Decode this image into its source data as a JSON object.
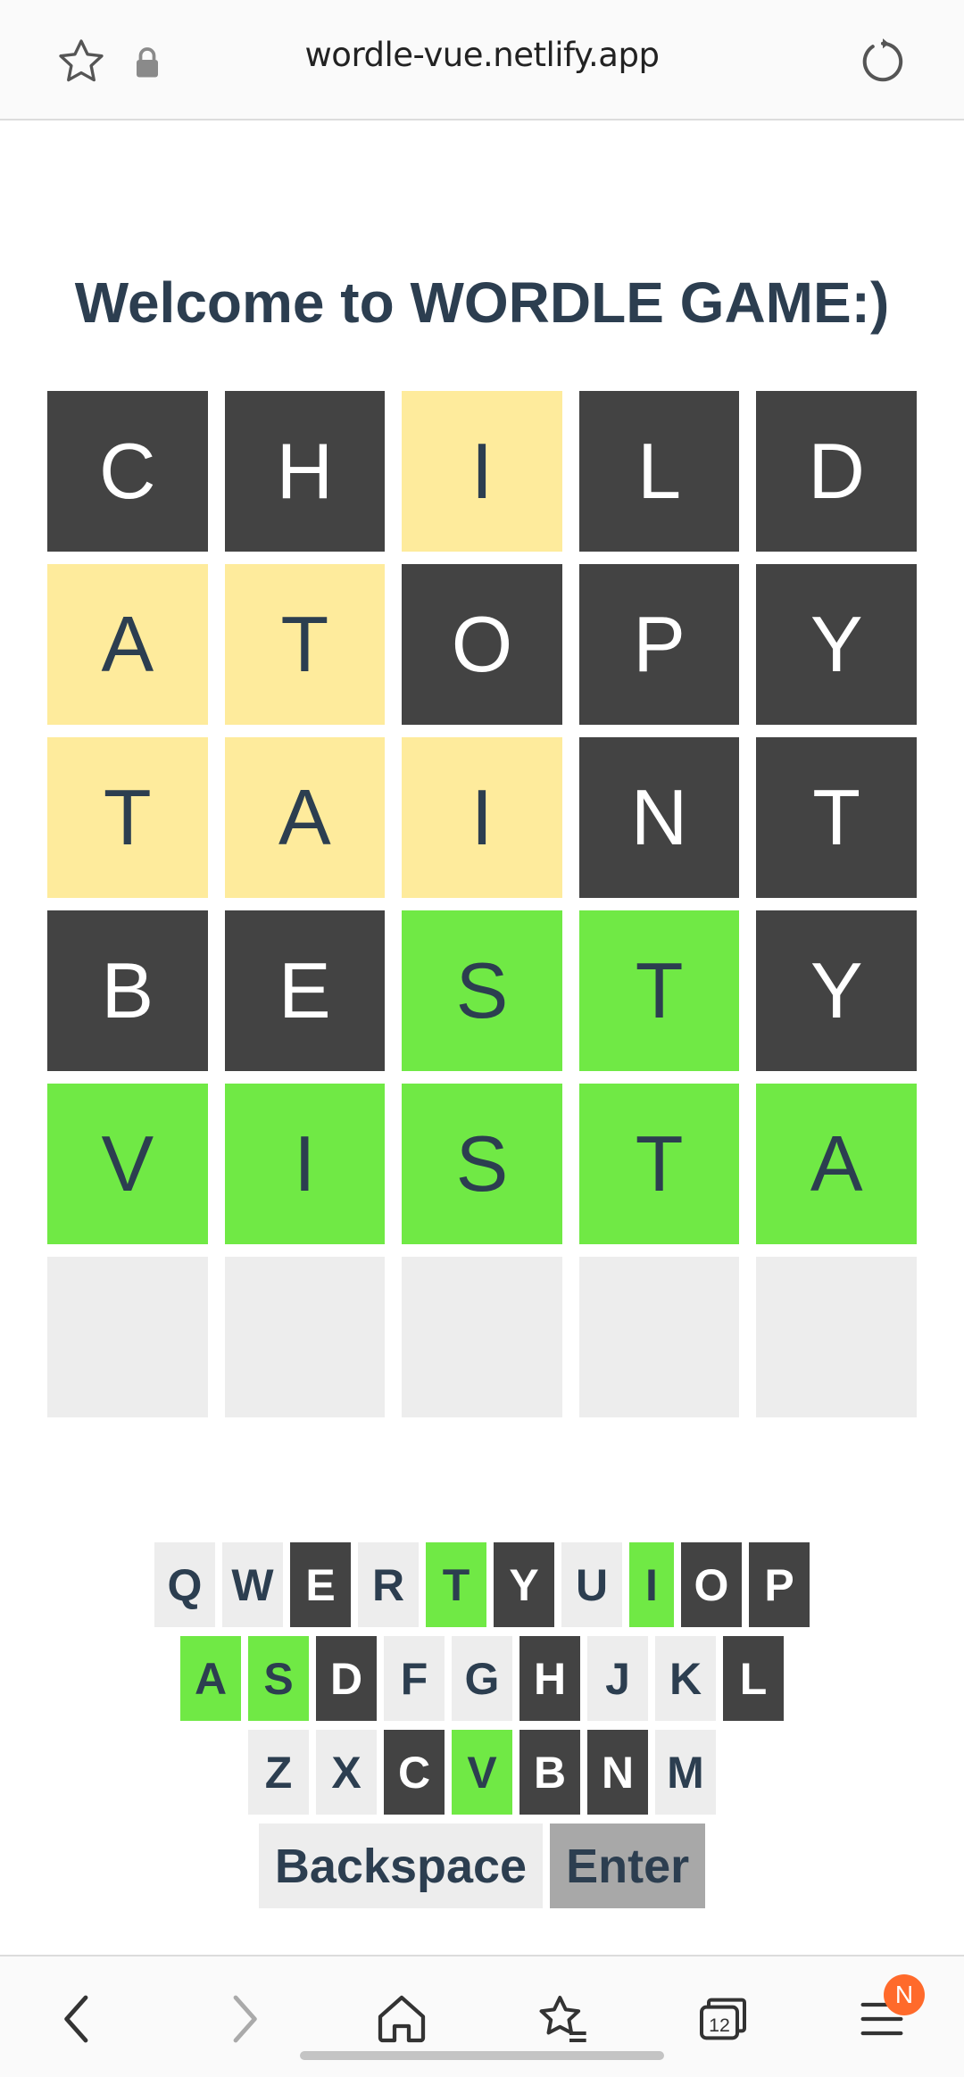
{
  "browser": {
    "url": "wordle-vue.netlify.app",
    "tab_count": "12",
    "notification_badge": "N"
  },
  "game": {
    "title": "Welcome to WORDLE GAME:)",
    "board": [
      [
        {
          "l": "C",
          "s": "absent"
        },
        {
          "l": "H",
          "s": "absent"
        },
        {
          "l": "I",
          "s": "present"
        },
        {
          "l": "L",
          "s": "absent"
        },
        {
          "l": "D",
          "s": "absent"
        }
      ],
      [
        {
          "l": "A",
          "s": "present"
        },
        {
          "l": "T",
          "s": "present"
        },
        {
          "l": "O",
          "s": "absent"
        },
        {
          "l": "P",
          "s": "absent"
        },
        {
          "l": "Y",
          "s": "absent"
        }
      ],
      [
        {
          "l": "T",
          "s": "present"
        },
        {
          "l": "A",
          "s": "present"
        },
        {
          "l": "I",
          "s": "present"
        },
        {
          "l": "N",
          "s": "absent"
        },
        {
          "l": "T",
          "s": "absent"
        }
      ],
      [
        {
          "l": "B",
          "s": "absent"
        },
        {
          "l": "E",
          "s": "absent"
        },
        {
          "l": "S",
          "s": "correct"
        },
        {
          "l": "T",
          "s": "correct"
        },
        {
          "l": "Y",
          "s": "absent"
        }
      ],
      [
        {
          "l": "V",
          "s": "correct"
        },
        {
          "l": "I",
          "s": "correct"
        },
        {
          "l": "S",
          "s": "correct"
        },
        {
          "l": "T",
          "s": "correct"
        },
        {
          "l": "A",
          "s": "correct"
        }
      ],
      [
        {
          "l": "",
          "s": "empty"
        },
        {
          "l": "",
          "s": "empty"
        },
        {
          "l": "",
          "s": "empty"
        },
        {
          "l": "",
          "s": "empty"
        },
        {
          "l": "",
          "s": "empty"
        }
      ]
    ]
  },
  "keyboard": {
    "rows": [
      [
        {
          "k": "Q",
          "s": "unused"
        },
        {
          "k": "W",
          "s": "unused"
        },
        {
          "k": "E",
          "s": "absent"
        },
        {
          "k": "R",
          "s": "unused"
        },
        {
          "k": "T",
          "s": "correct"
        },
        {
          "k": "Y",
          "s": "absent"
        },
        {
          "k": "U",
          "s": "unused"
        },
        {
          "k": "I",
          "s": "correct"
        },
        {
          "k": "O",
          "s": "absent"
        },
        {
          "k": "P",
          "s": "absent"
        }
      ],
      [
        {
          "k": "A",
          "s": "correct"
        },
        {
          "k": "S",
          "s": "correct"
        },
        {
          "k": "D",
          "s": "absent"
        },
        {
          "k": "F",
          "s": "unused"
        },
        {
          "k": "G",
          "s": "unused"
        },
        {
          "k": "H",
          "s": "absent"
        },
        {
          "k": "J",
          "s": "unused"
        },
        {
          "k": "K",
          "s": "unused"
        },
        {
          "k": "L",
          "s": "absent"
        }
      ],
      [
        {
          "k": "Z",
          "s": "unused"
        },
        {
          "k": "X",
          "s": "unused"
        },
        {
          "k": "C",
          "s": "absent"
        },
        {
          "k": "V",
          "s": "correct"
        },
        {
          "k": "B",
          "s": "absent"
        },
        {
          "k": "N",
          "s": "absent"
        },
        {
          "k": "M",
          "s": "unused"
        }
      ]
    ],
    "backspace_label": "Backspace",
    "enter_label": "Enter"
  },
  "colors": {
    "absent": "#434343",
    "present": "#feeb9c",
    "correct": "#70e945",
    "empty": "#ededed",
    "text": "#2c3e50"
  },
  "icons": {
    "bookmark": "star-icon",
    "secure": "lock-icon",
    "reload": "reload-icon",
    "back": "chevron-left-icon",
    "forward": "chevron-right-icon",
    "home": "home-icon",
    "favorites": "star-list-icon",
    "tabs": "tabs-icon",
    "menu": "menu-icon"
  }
}
